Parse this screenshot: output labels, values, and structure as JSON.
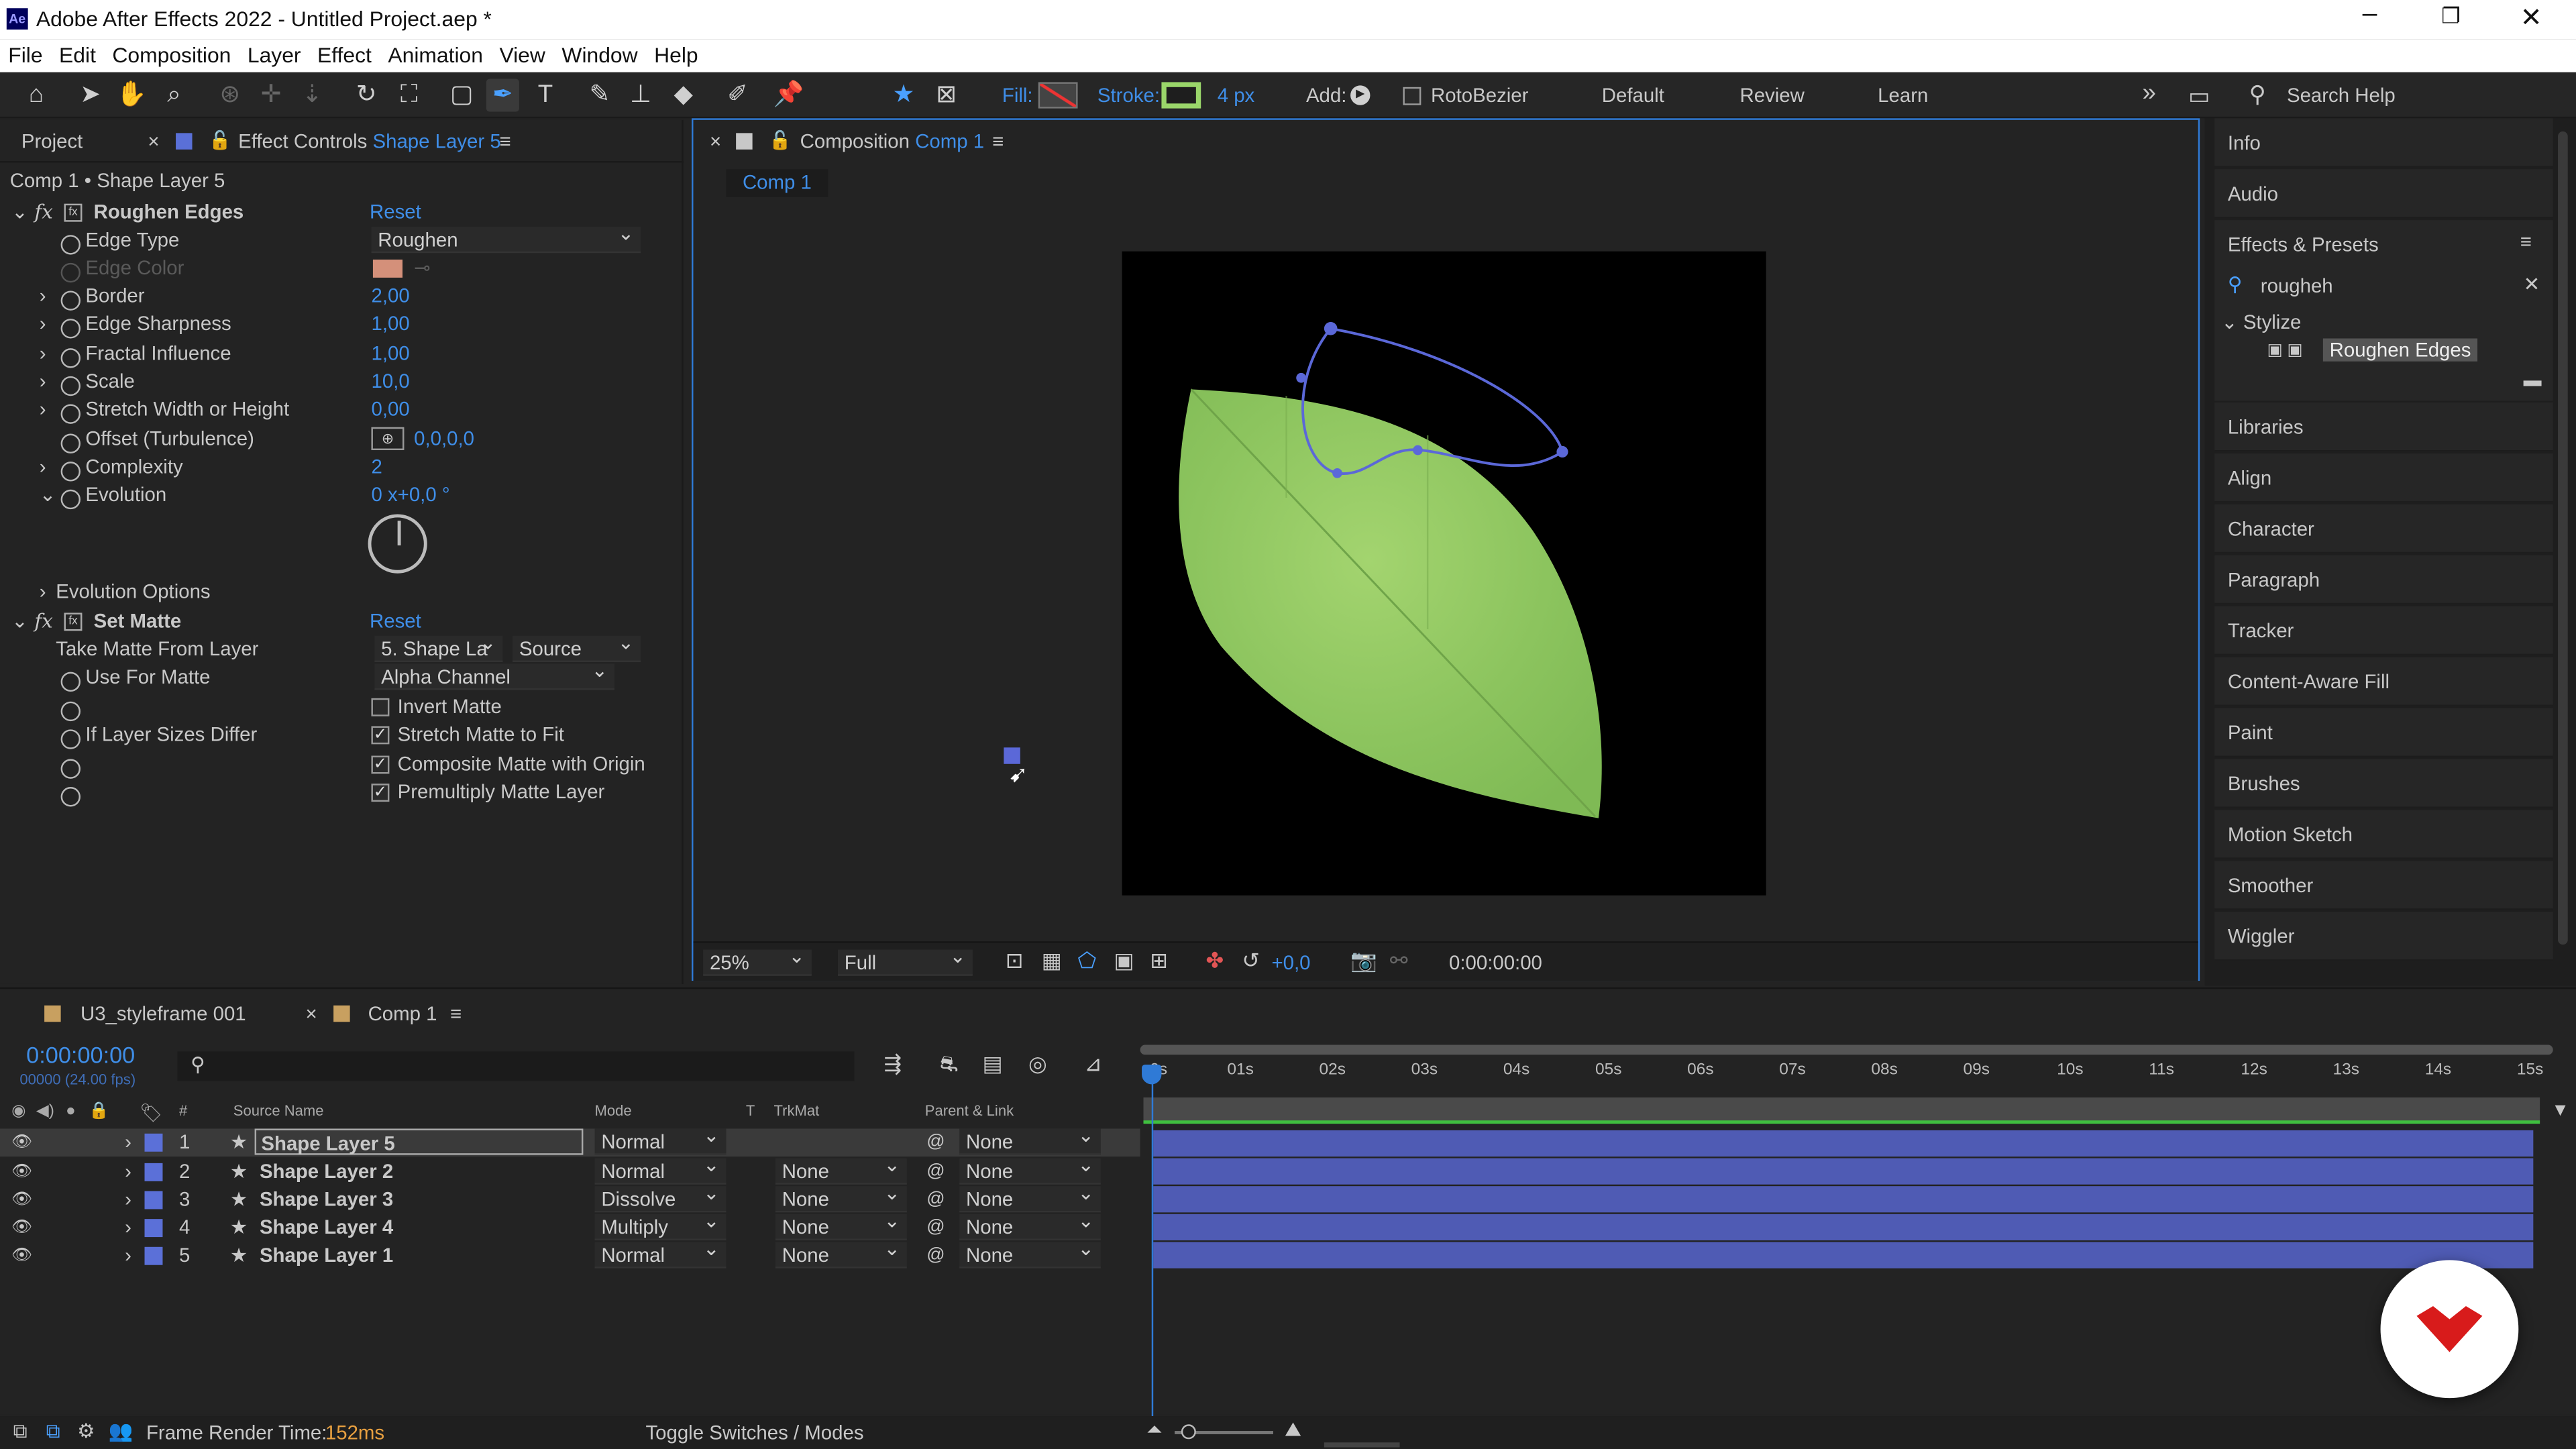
{
  "title": "Adobe After Effects 2022 - Untitled Project.aep *",
  "menu": [
    "File",
    "Edit",
    "Composition",
    "Layer",
    "Effect",
    "Animation",
    "View",
    "Window",
    "Help"
  ],
  "toolbar": {
    "fill_label": "Fill:",
    "stroke_label": "Stroke:",
    "stroke_width": "4 px",
    "add_label": "Add:",
    "rotobezier": "RotoBezier",
    "workspaces": [
      "Default",
      "Review",
      "Learn"
    ],
    "search_placeholder": "Search Help"
  },
  "effect_controls": {
    "project_tab": "Project",
    "tab_prefix": "Effect Controls",
    "tab_layer": "Shape Layer 5",
    "path": "Comp 1 • Shape Layer 5",
    "roughen": {
      "name": "Roughen Edges",
      "reset": "Reset",
      "props": [
        {
          "label": "Edge Type",
          "value": "Roughen"
        },
        {
          "label": "Edge Color",
          "value": ""
        },
        {
          "label": "Border",
          "value": "2,00"
        },
        {
          "label": "Edge Sharpness",
          "value": "1,00"
        },
        {
          "label": "Fractal Influence",
          "value": "1,00"
        },
        {
          "label": "Scale",
          "value": "10,0"
        },
        {
          "label": "Stretch Width or Height",
          "value": "0,00"
        },
        {
          "label": "Offset (Turbulence)",
          "value": "0,0,0,0"
        },
        {
          "label": "Complexity",
          "value": "2"
        },
        {
          "label": "Evolution",
          "value": "0 x+0,0 °"
        }
      ],
      "evolution_options": "Evolution Options"
    },
    "set_matte": {
      "name": "Set Matte",
      "reset": "Reset",
      "take_matte_label": "Take Matte From Layer",
      "take_matte_value": "5. Shape La",
      "take_matte_source": "Source",
      "use_for_label": "Use For Matte",
      "use_for_value": "Alpha Channel",
      "invert": "Invert Matte",
      "if_sizes_label": "If Layer Sizes Differ",
      "stretch": "Stretch Matte to Fit",
      "composite": "Composite Matte with Origin",
      "premultiply": "Premultiply Matte Layer"
    }
  },
  "composition": {
    "tab_prefix": "Composition",
    "tab_name": "Comp 1",
    "breadcrumb": "Comp 1",
    "zoom": "25%",
    "resolution": "Full",
    "exposure": "+0,0",
    "timecode": "0:00:00:00"
  },
  "right_panel": {
    "items_top": [
      "Info",
      "Audio"
    ],
    "effects_presets": "Effects & Presets",
    "search_value": "rougheh",
    "category": "Stylize",
    "result": "Roughen Edges",
    "items": [
      "Libraries",
      "Align",
      "Character",
      "Paragraph",
      "Tracker",
      "Content-Aware Fill",
      "Paint",
      "Brushes",
      "Motion Sketch",
      "Smoother",
      "Wiggler"
    ]
  },
  "timeline": {
    "tab1": "U3_styleframe 001",
    "tab2": "Comp 1",
    "timecode": "0:00:00:00",
    "fps": "00000 (24.00 fps)",
    "col_source": "Source Name",
    "col_mode": "Mode",
    "col_t": "T",
    "col_trkmat": "TrkMat",
    "col_parent": "Parent & Link",
    "ruler": [
      "0s",
      "01s",
      "02s",
      "03s",
      "04s",
      "05s",
      "06s",
      "07s",
      "08s",
      "09s",
      "10s",
      "11s",
      "12s",
      "13s",
      "14s",
      "15s"
    ],
    "layers": [
      {
        "num": "1",
        "name": "Shape Layer 5",
        "mode": "Normal",
        "trkmat": "",
        "parent": "None"
      },
      {
        "num": "2",
        "name": "Shape Layer 2",
        "mode": "Normal",
        "trkmat": "None",
        "parent": "None"
      },
      {
        "num": "3",
        "name": "Shape Layer 3",
        "mode": "Dissolve",
        "trkmat": "None",
        "parent": "None"
      },
      {
        "num": "4",
        "name": "Shape Layer 4",
        "mode": "Multiply",
        "trkmat": "None",
        "parent": "None"
      },
      {
        "num": "5",
        "name": "Shape Layer 1",
        "mode": "Normal",
        "trkmat": "None",
        "parent": "None"
      }
    ]
  },
  "status": {
    "frame_render_label": "Frame Render Time:",
    "frame_render_value": "152ms",
    "toggle": "Toggle Switches / Modes"
  },
  "colors": {
    "accent": "#3f8ee8",
    "layer_bar": "#4f5bb4",
    "leaf": "#8fc862",
    "edge_color": "#d4907a"
  }
}
